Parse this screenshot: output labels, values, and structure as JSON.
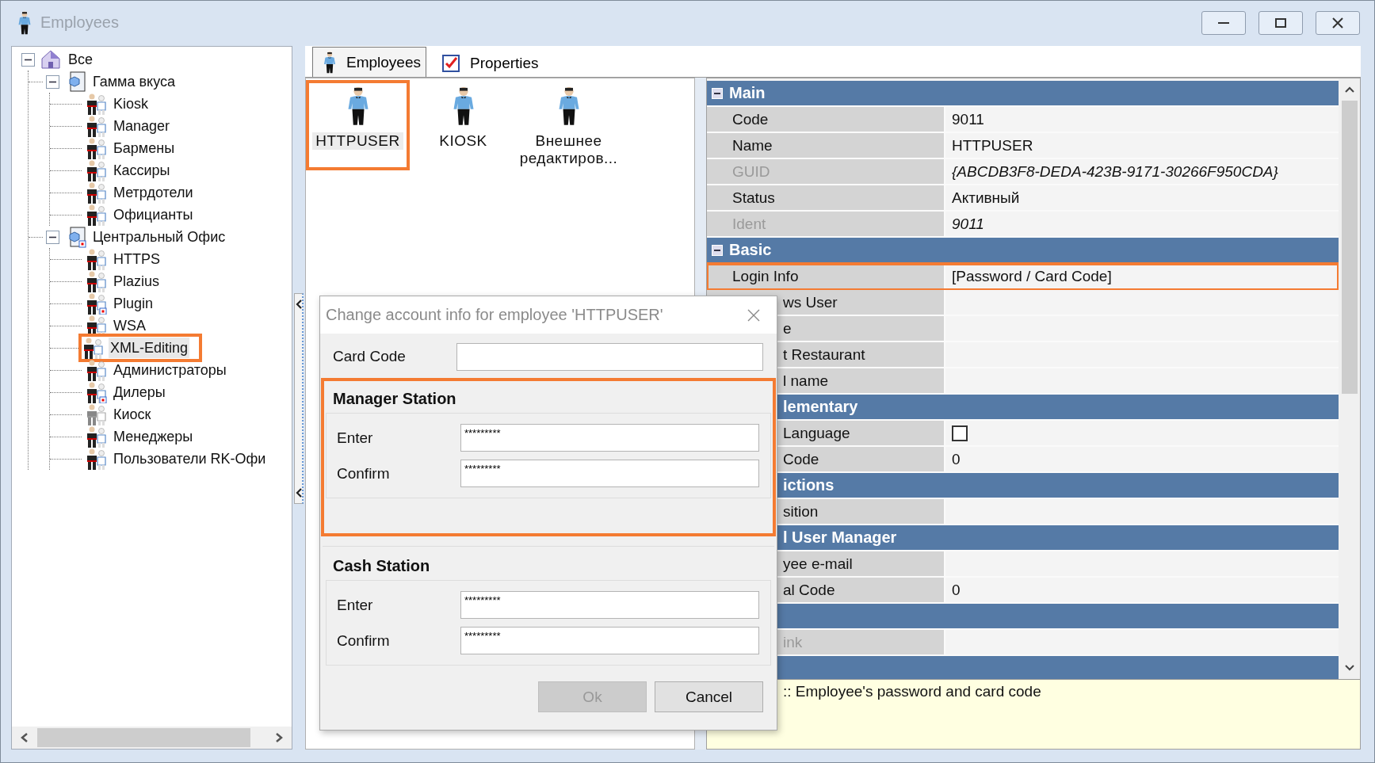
{
  "window": {
    "title": "Employees"
  },
  "tree": [
    {
      "label": "Все",
      "kind": "root",
      "expanded": true,
      "selected": false,
      "children": [
        {
          "label": "Гамма вкуса",
          "kind": "group",
          "expanded": true,
          "selected": false,
          "badge": false,
          "children": [
            {
              "label": "Kiosk",
              "kind": "role",
              "selected": false
            },
            {
              "label": "Manager",
              "kind": "role",
              "selected": false
            },
            {
              "label": "Бармены",
              "kind": "role",
              "selected": false
            },
            {
              "label": "Кассиры",
              "kind": "role",
              "selected": false
            },
            {
              "label": "Метрдотели",
              "kind": "role",
              "selected": false
            },
            {
              "label": "Официанты",
              "kind": "role",
              "selected": false
            }
          ]
        },
        {
          "label": "Центральный Офис",
          "kind": "group",
          "expanded": true,
          "selected": false,
          "badge": true,
          "children": [
            {
              "label": "HTTPS",
              "kind": "role",
              "selected": false
            },
            {
              "label": "Plazius",
              "kind": "role",
              "selected": false
            },
            {
              "label": "Plugin",
              "kind": "role",
              "selected": false,
              "badge": true
            },
            {
              "label": "WSA",
              "kind": "role",
              "selected": false
            },
            {
              "label": "XML-Editing",
              "kind": "role",
              "selected": true,
              "highlighted": true
            },
            {
              "label": "Администраторы",
              "kind": "role",
              "selected": false
            },
            {
              "label": "Дилеры",
              "kind": "role",
              "selected": false,
              "badge": true
            },
            {
              "label": "Киоск",
              "kind": "role",
              "selected": false,
              "disabled": true
            },
            {
              "label": "Менеджеры",
              "kind": "role",
              "selected": false
            },
            {
              "label": "Пользователи RK-Офи",
              "kind": "role",
              "selected": false
            }
          ]
        }
      ]
    }
  ],
  "tabs": [
    {
      "label": "Employees",
      "kind": "employees",
      "selected": true
    },
    {
      "label": "Properties",
      "kind": "properties",
      "selected": false
    }
  ],
  "employees": [
    {
      "label": "HTTPUSER",
      "selected": true,
      "highlighted": true
    },
    {
      "label": "KIOSK",
      "selected": false
    },
    {
      "label": "Внешнее редактиров...",
      "selected": false
    }
  ],
  "properties": {
    "rows": [
      {
        "kind": "header",
        "label": "Main"
      },
      {
        "kind": "text",
        "label": "Code",
        "value": "9011"
      },
      {
        "kind": "text",
        "label": "Name",
        "value": "HTTPUSER"
      },
      {
        "kind": "text",
        "label": "GUID",
        "value": "{ABCDB3F8-DEDA-423B-9171-30266F950CDA}",
        "disabled": true
      },
      {
        "kind": "text",
        "label": "Status",
        "value": "Активный"
      },
      {
        "kind": "text",
        "label": "Ident",
        "value": "9011",
        "disabled": true
      },
      {
        "kind": "header",
        "label": "Basic"
      },
      {
        "kind": "text",
        "label": "Login Info",
        "value": "[Password / Card Code]",
        "highlighted": true
      },
      {
        "kind": "text",
        "label": "ws User",
        "partial": true
      },
      {
        "kind": "text",
        "label": "e",
        "partial": true
      },
      {
        "kind": "text",
        "label": "t Restaurant",
        "partial": true
      },
      {
        "kind": "text",
        "label": "l name",
        "partial": true
      },
      {
        "kind": "header",
        "label": "lementary",
        "partial": true
      },
      {
        "kind": "checkbox",
        "label": "Language",
        "partial": true,
        "checked": false
      },
      {
        "kind": "text",
        "label": "Code",
        "value": "0",
        "partial": true
      },
      {
        "kind": "header",
        "label": "ictions",
        "partial": true
      },
      {
        "kind": "text",
        "label": "sition",
        "partial": true
      },
      {
        "kind": "header",
        "label": "l User Manager",
        "partial": true
      },
      {
        "kind": "text",
        "label": "yee e-mail",
        "partial": true
      },
      {
        "kind": "text",
        "label": "al Code",
        "value": "0",
        "partial": true
      },
      {
        "kind": "header",
        "partial": true
      },
      {
        "kind": "text",
        "label": "ink",
        "partial": true,
        "disabled": true
      },
      {
        "kind": "header",
        "partial": true
      }
    ],
    "description": ":: Employee's password and card code"
  },
  "dialog": {
    "title": "Change account info for employee 'HTTPUSER'",
    "card_code": {
      "label": "Card Code"
    },
    "groups": [
      {
        "title": "Manager Station",
        "highlighted": true,
        "fields": [
          {
            "label": "Enter",
            "value": "*********"
          },
          {
            "label": "Confirm",
            "value": "*********"
          }
        ]
      },
      {
        "title": "Cash Station",
        "highlighted": false,
        "fields": [
          {
            "label": "Enter",
            "value": "*********"
          },
          {
            "label": "Confirm",
            "value": "*********"
          }
        ]
      }
    ],
    "buttons": [
      {
        "label": "Ok",
        "disabled": true
      },
      {
        "label": "Cancel",
        "disabled": false
      }
    ]
  }
}
